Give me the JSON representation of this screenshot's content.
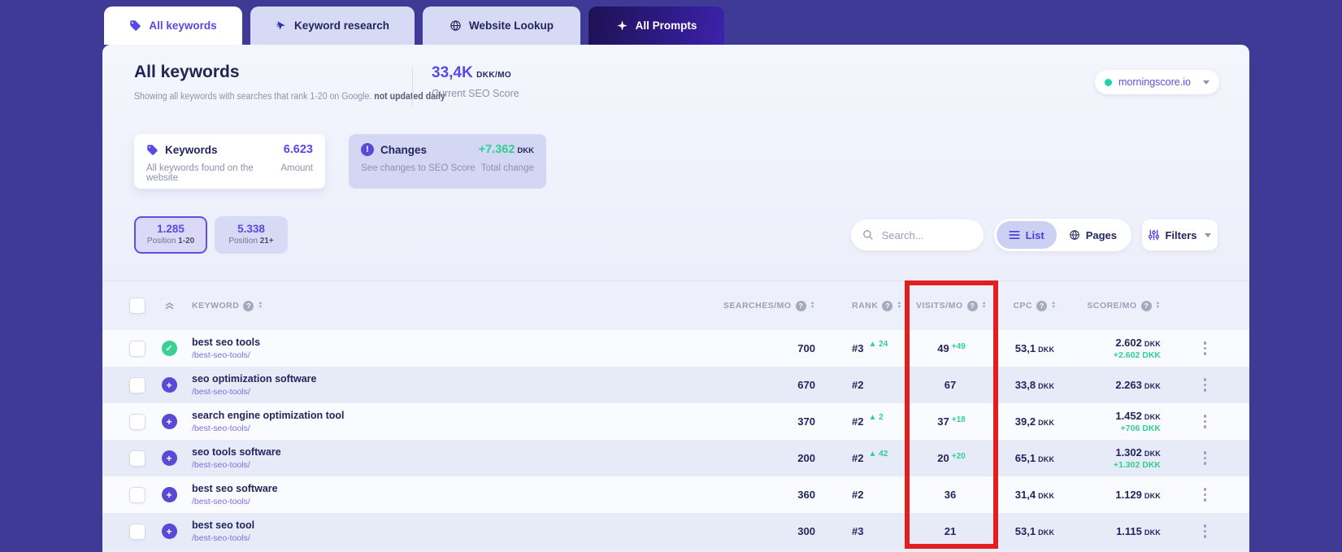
{
  "colors": {
    "accent": "#5849e6",
    "green": "#2fcf96",
    "highlight_red": "#e41e1e",
    "dark_background": "#403a97"
  },
  "tabs": [
    {
      "label": "All keywords",
      "icon": "tag-icon",
      "active": true
    },
    {
      "label": "Keyword research",
      "icon": "cursor-icon",
      "active": false
    },
    {
      "label": "Website Lookup",
      "icon": "globe-icon",
      "active": false
    },
    {
      "label": "All Prompts",
      "icon": "prompts-icon",
      "active": false
    }
  ],
  "header": {
    "title": "All keywords",
    "subtitle": "Showing all keywords with searches that rank 1-20 on Google.",
    "subtitle_bold": "not updated daily",
    "score_value": "33,4K",
    "score_unit": "DKK/MO",
    "score_label": "Current SEO Score",
    "site_selector": {
      "label": "morningscore.io"
    }
  },
  "cards": [
    {
      "title": "Keywords",
      "value": "6.623",
      "description": "All keywords found on the website",
      "value_label": "Amount"
    },
    {
      "title": "Changes",
      "value": "+7.362",
      "value_suffix": "DKK",
      "description": "See changes to SEO Score",
      "value_label": "Total change"
    }
  ],
  "toolbar": {
    "position_buttons": [
      {
        "value": "1.285",
        "label": "Position",
        "label_bold": "1-20",
        "active": true
      },
      {
        "value": "5.338",
        "label": "Position",
        "label_bold": "21+",
        "active": false
      }
    ],
    "search_placeholder": "Search...",
    "view_toggle": [
      {
        "label": "List",
        "icon": "list-icon",
        "active": true
      },
      {
        "label": "Pages",
        "icon": "globe-icon",
        "active": false
      }
    ],
    "filters_label": "Filters"
  },
  "table": {
    "currency": "DKK",
    "columns": {
      "keyword": "KEYWORD",
      "searches": "SEARCHES/MO",
      "rank": "RANK",
      "visits": "VISITS/MO",
      "cpc": "CPC",
      "score": "SCORE/MO"
    },
    "rows": [
      {
        "status": "check",
        "keyword": "best seo tools",
        "url": "/best-seo-tools/",
        "searches": "700",
        "rank": "#3",
        "rank_change": "24",
        "visits": "49",
        "visits_change": "+49",
        "cpc": "53,1",
        "score": "2.602",
        "score_change": "+2.602"
      },
      {
        "status": "plus",
        "keyword": "seo optimization software",
        "url": "/best-seo-tools/",
        "searches": "670",
        "rank": "#2",
        "rank_change": "",
        "visits": "67",
        "visits_change": "",
        "cpc": "33,8",
        "score": "2.263",
        "score_change": ""
      },
      {
        "status": "plus",
        "keyword": "search engine optimization tool",
        "url": "/best-seo-tools/",
        "searches": "370",
        "rank": "#2",
        "rank_change": "2",
        "visits": "37",
        "visits_change": "+18",
        "cpc": "39,2",
        "score": "1.452",
        "score_change": "+706"
      },
      {
        "status": "plus",
        "keyword": "seo tools software",
        "url": "/best-seo-tools/",
        "searches": "200",
        "rank": "#2",
        "rank_change": "42",
        "visits": "20",
        "visits_change": "+20",
        "cpc": "65,1",
        "score": "1.302",
        "score_change": "+1.302"
      },
      {
        "status": "plus",
        "keyword": "best seo software",
        "url": "/best-seo-tools/",
        "searches": "360",
        "rank": "#2",
        "rank_change": "",
        "visits": "36",
        "visits_change": "",
        "cpc": "31,4",
        "score": "1.129",
        "score_change": ""
      },
      {
        "status": "plus",
        "keyword": "best seo tool",
        "url": "/best-seo-tools/",
        "searches": "300",
        "rank": "#3",
        "rank_change": "",
        "visits": "21",
        "visits_change": "",
        "cpc": "53,1",
        "score": "1.115",
        "score_change": ""
      }
    ]
  }
}
